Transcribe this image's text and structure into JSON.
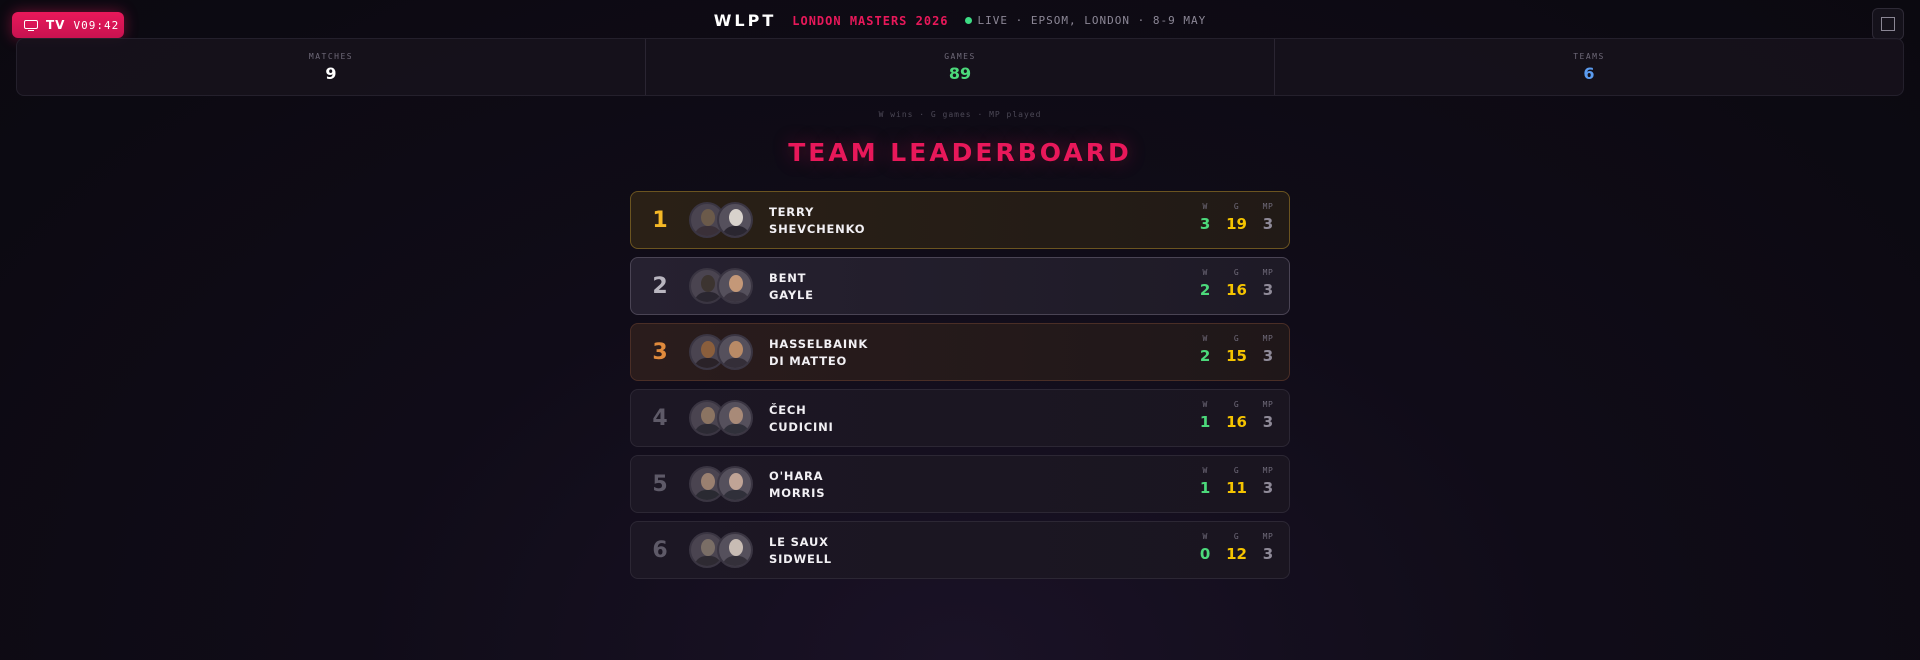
{
  "header": {
    "tv_label": "TV",
    "version": "V09:42",
    "logo": "WLPT",
    "event": "LONDON MASTERS 2026",
    "live_text": "LIVE · EPSOM, LONDON · 8-9 MAY",
    "fullscreen_icon": "expand-icon"
  },
  "stats": [
    {
      "label": "MATCHES",
      "value": "9",
      "color": "#ffffff"
    },
    {
      "label": "GAMES",
      "value": "89",
      "color": "#4cd97b"
    },
    {
      "label": "TEAMS",
      "value": "6",
      "color": "#5b9cf0"
    }
  ],
  "legend": "W wins · G games · MP played",
  "title": "TEAM LEADERBOARD",
  "metric_labels": {
    "w": "W",
    "g": "G",
    "mp": "MP"
  },
  "teams": [
    {
      "rank": "1",
      "players": [
        "TERRY",
        "SHEVCHENKO"
      ],
      "w": "3",
      "g": "19",
      "mp": "3",
      "rank_color": "#f5b826"
    },
    {
      "rank": "2",
      "players": [
        "BENT",
        "GAYLE"
      ],
      "w": "2",
      "g": "16",
      "mp": "3",
      "rank_color": "#b9b6c0"
    },
    {
      "rank": "3",
      "players": [
        "HASSELBAINK",
        "DI MATTEO"
      ],
      "w": "2",
      "g": "15",
      "mp": "3",
      "rank_color": "#e08a3c"
    },
    {
      "rank": "4",
      "players": [
        "ČECH",
        "CUDICINI"
      ],
      "w": "1",
      "g": "16",
      "mp": "3",
      "rank_color": "#5e5a68"
    },
    {
      "rank": "5",
      "players": [
        "O'HARA",
        "MORRIS"
      ],
      "w": "1",
      "g": "11",
      "mp": "3",
      "rank_color": "#5e5a68"
    },
    {
      "rank": "6",
      "players": [
        "LE SAUX",
        "SIDWELL"
      ],
      "w": "0",
      "g": "12",
      "mp": "3",
      "rank_color": "#5e5a68"
    }
  ]
}
